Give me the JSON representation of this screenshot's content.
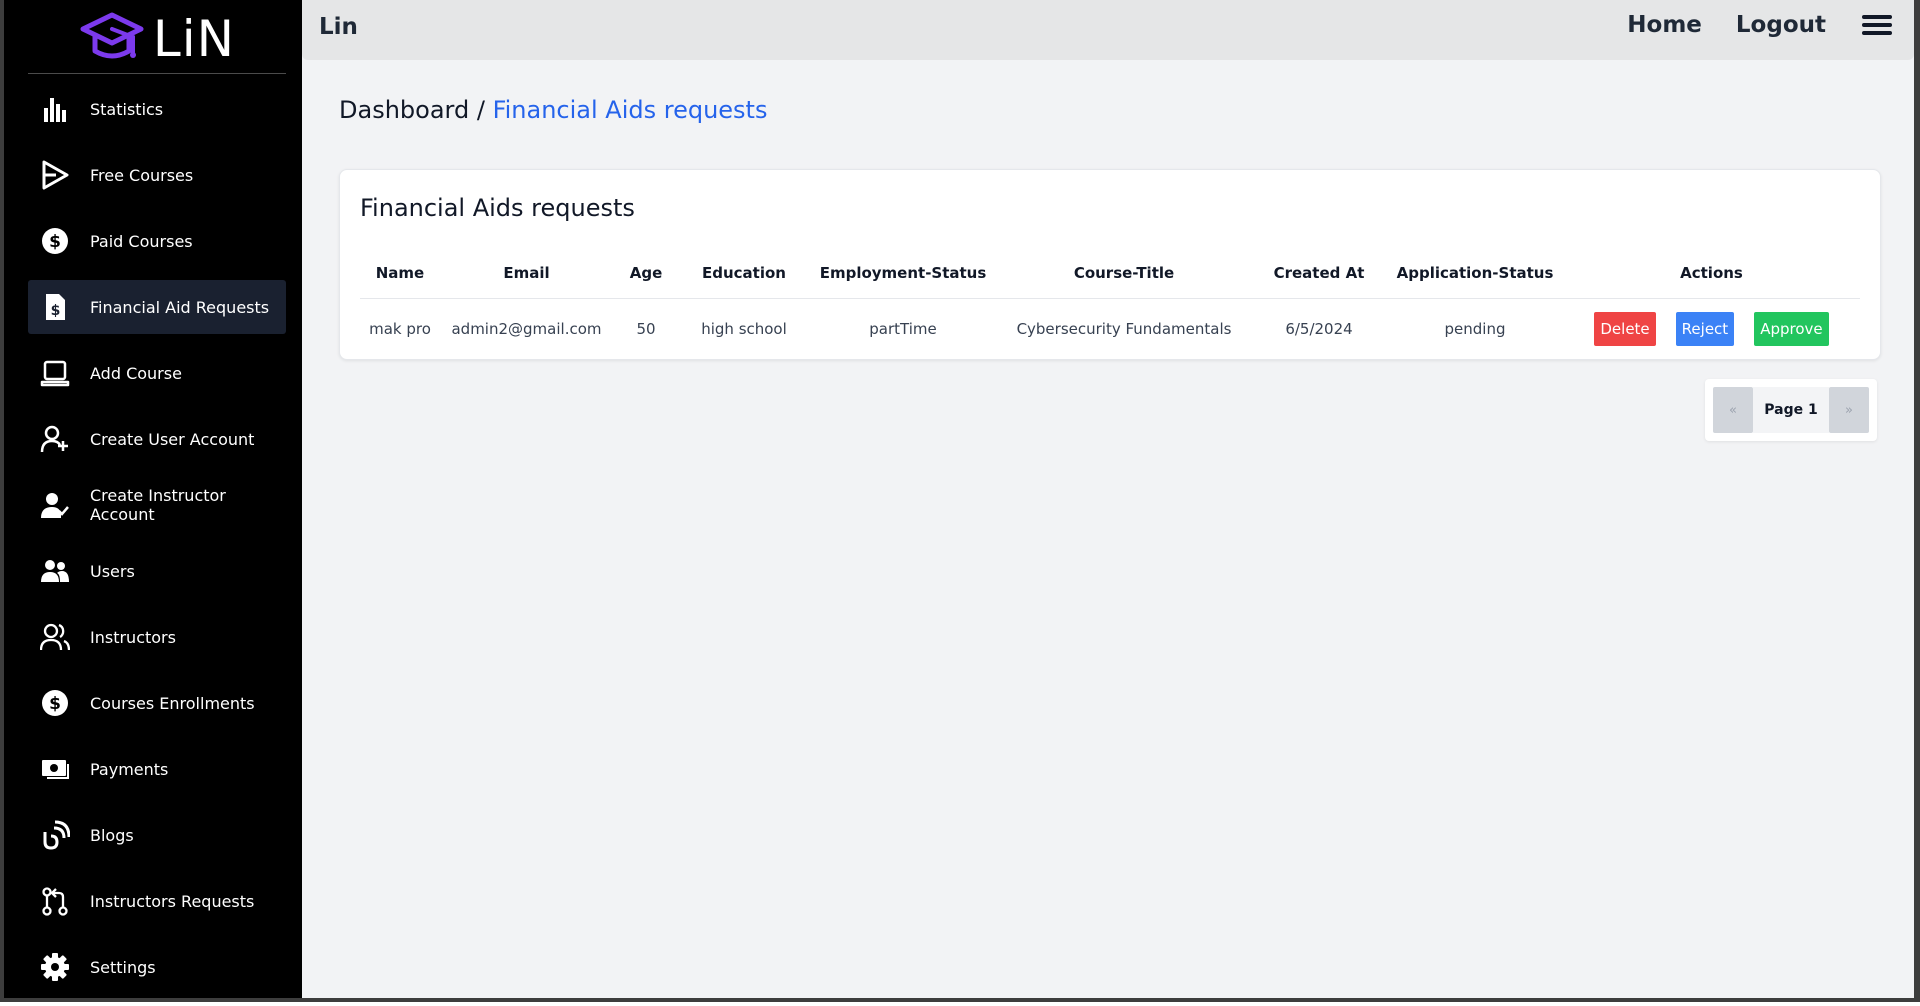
{
  "app": {
    "logo_text": "LiN",
    "brand": "Lin"
  },
  "sidebar": {
    "items": [
      {
        "label": "Statistics",
        "icon": "bar-chart-icon"
      },
      {
        "label": "Free Courses",
        "icon": "play-icon"
      },
      {
        "label": "Paid Courses",
        "icon": "dollar-icon"
      },
      {
        "label": "Financial Aid Requests",
        "icon": "dollar-file-icon",
        "active": true
      },
      {
        "label": "Add Course",
        "icon": "laptop-icon"
      },
      {
        "label": "Create User Account",
        "icon": "user-plus-icon"
      },
      {
        "label": "Create Instructor Account",
        "icon": "user-check-icon"
      },
      {
        "label": "Users",
        "icon": "users-icon"
      },
      {
        "label": "Instructors",
        "icon": "users-outline-icon"
      },
      {
        "label": "Courses Enrollments",
        "icon": "dollar-icon"
      },
      {
        "label": "Payments",
        "icon": "money-bill-icon"
      },
      {
        "label": "Blogs",
        "icon": "blog-icon"
      },
      {
        "label": "Instructors Requests",
        "icon": "git-pull-request-icon"
      },
      {
        "label": "Settings",
        "icon": "gear-icon"
      }
    ]
  },
  "topbar": {
    "home": "Home",
    "logout": "Logout"
  },
  "breadcrumb": {
    "root": "Dashboard",
    "separator": " / ",
    "current": "Financial Aids requests"
  },
  "card": {
    "title": "Financial Aids requests"
  },
  "table": {
    "headers": [
      "Name",
      "Email",
      "Age",
      "Education",
      "Employment-Status",
      "Course-Title",
      "Created At",
      "Application-Status",
      "Actions"
    ],
    "rows": [
      {
        "name": "mak pro",
        "email": "admin2@gmail.com",
        "age": "50",
        "education": "high school",
        "employment": "partTime",
        "course": "Cybersecurity Fundamentals",
        "created": "6/5/2024",
        "status": "pending"
      }
    ],
    "actions": {
      "delete": "Delete",
      "reject": "Reject",
      "approve": "Approve"
    }
  },
  "pagination": {
    "prev": "«",
    "page": "Page 1",
    "next": "»"
  },
  "colors": {
    "accent": "#2563eb",
    "logo": "#7c3aed",
    "delete": "#ef4444",
    "reject": "#3b82f6",
    "approve": "#22c55e"
  }
}
